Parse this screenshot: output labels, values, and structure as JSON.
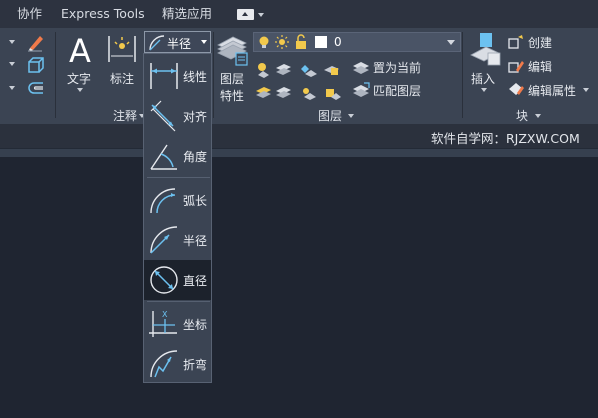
{
  "tabs": [
    {
      "label": "协作"
    },
    {
      "label": "Express Tools"
    },
    {
      "label": "精选应用"
    }
  ],
  "ribbon": {
    "annotation": {
      "text_label": "文字",
      "dim_label": "标注",
      "title": "注释",
      "dim_button_label": "半径"
    },
    "layers": {
      "props_label_line1": "图层",
      "props_label_line2": "特性",
      "layer_value": "0",
      "set_current_label": "置为当前",
      "match_layer_label": "匹配图层",
      "title": "图层"
    },
    "block": {
      "insert_label": "插入",
      "create_label": "创建",
      "edit_label": "编辑",
      "edit_attr_label": "编辑属性",
      "title": "块"
    }
  },
  "dim_menu": [
    {
      "label": "线性",
      "icon": "linear-dimension-icon"
    },
    {
      "label": "对齐",
      "icon": "aligned-dimension-icon"
    },
    {
      "label": "角度",
      "icon": "angular-dimension-icon"
    },
    {
      "label": "弧长",
      "icon": "arc-length-dimension-icon"
    },
    {
      "label": "半径",
      "icon": "radius-dimension-icon"
    },
    {
      "label": "直径",
      "icon": "diameter-dimension-icon",
      "selected": true
    },
    {
      "label": "坐标",
      "icon": "ordinate-dimension-icon"
    },
    {
      "label": "折弯",
      "icon": "jogged-dimension-icon"
    }
  ],
  "watermark": "软件自学网：RJZXW.COM",
  "colors": {
    "ribbon_bg": "#3b4453",
    "tabbar_bg": "#2d3340",
    "canvas_bg": "#1f2531",
    "icon_blue": "#6cc1f0",
    "icon_yellow": "#f2c94c",
    "selected_bg": "#1c222c"
  }
}
